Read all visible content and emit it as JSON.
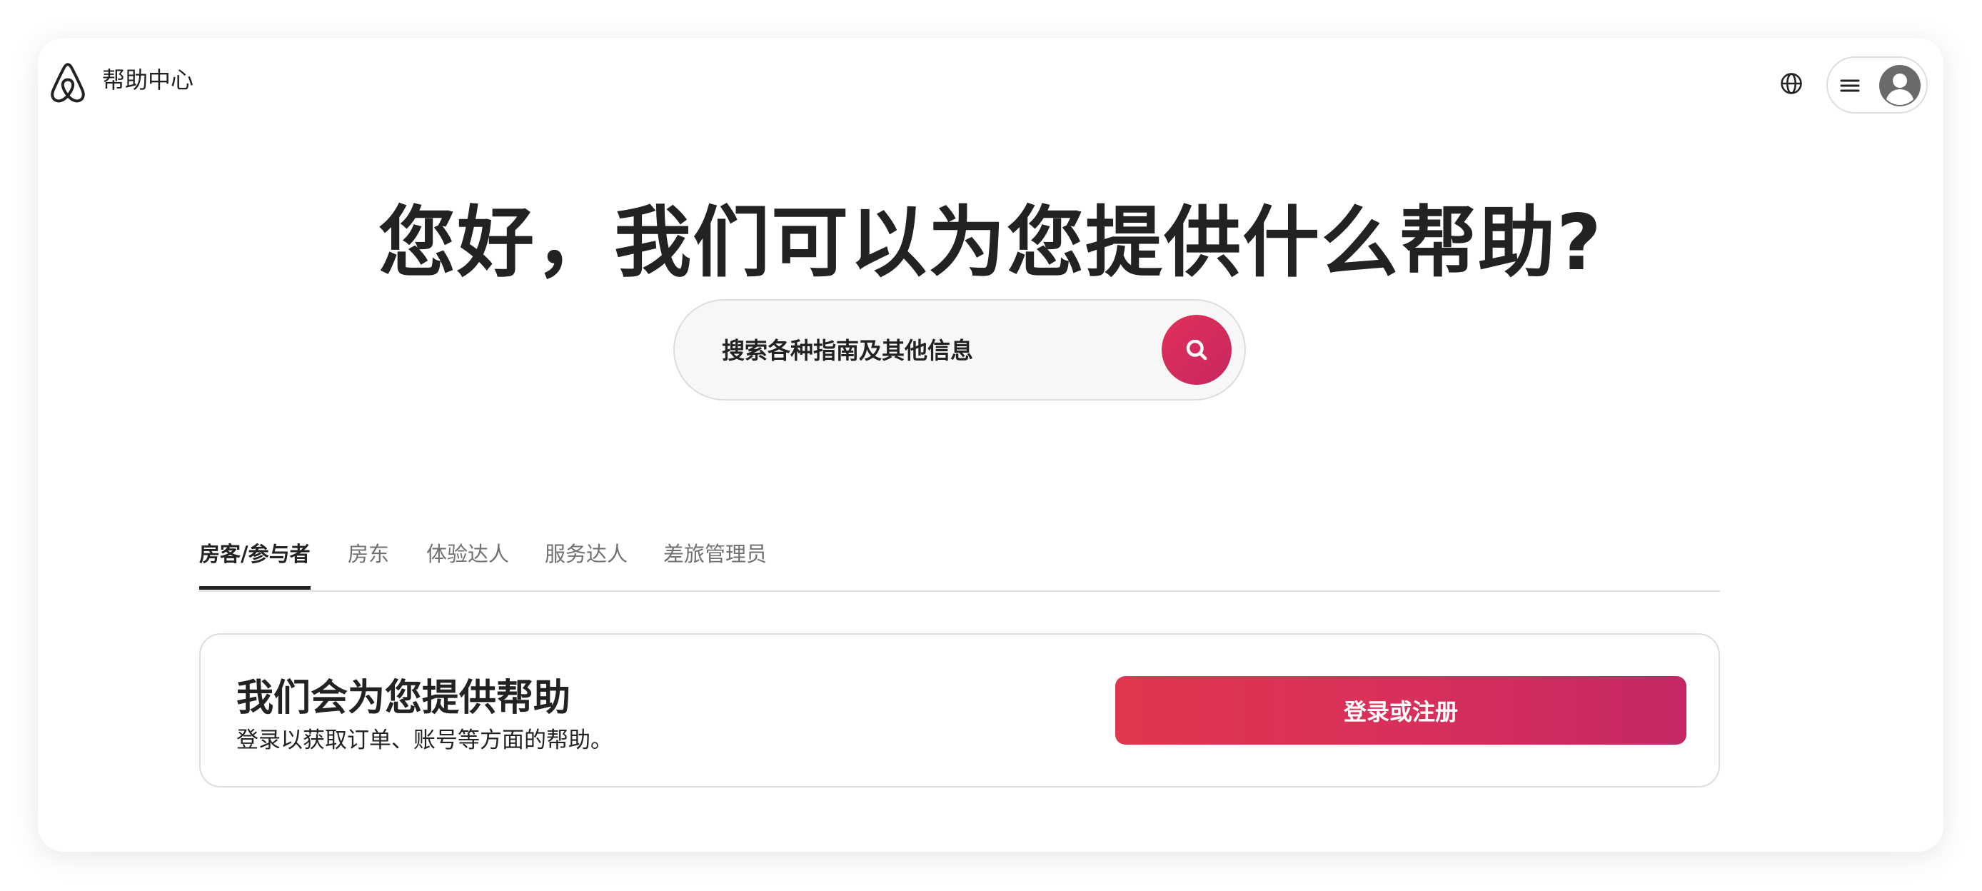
{
  "header": {
    "brand_title": "帮助中心",
    "logo_icon": "airbnb-logo-icon",
    "globe_icon": "globe-icon",
    "menu_icon": "hamburger-menu-icon",
    "avatar_icon": "user-avatar-icon"
  },
  "hero": {
    "title": "您好，我们可以为您提供什么帮助?"
  },
  "search": {
    "placeholder": "搜索各种指南及其他信息",
    "value": "",
    "button_icon": "search-icon",
    "button_color": "#d7305c"
  },
  "tabs": [
    {
      "label": "房客/参与者",
      "active": true
    },
    {
      "label": "房东",
      "active": false
    },
    {
      "label": "体验达人",
      "active": false
    },
    {
      "label": "服务达人",
      "active": false
    },
    {
      "label": "差旅管理员",
      "active": false
    }
  ],
  "help_card": {
    "title": "我们会为您提供帮助",
    "subtitle": "登录以获取订单、账号等方面的帮助。",
    "button_label": "登录或注册"
  },
  "colors": {
    "brand": "#e0364f",
    "brand_end": "#c52765",
    "text_primary": "#222222",
    "text_secondary": "#717171",
    "border": "#dddddd"
  }
}
